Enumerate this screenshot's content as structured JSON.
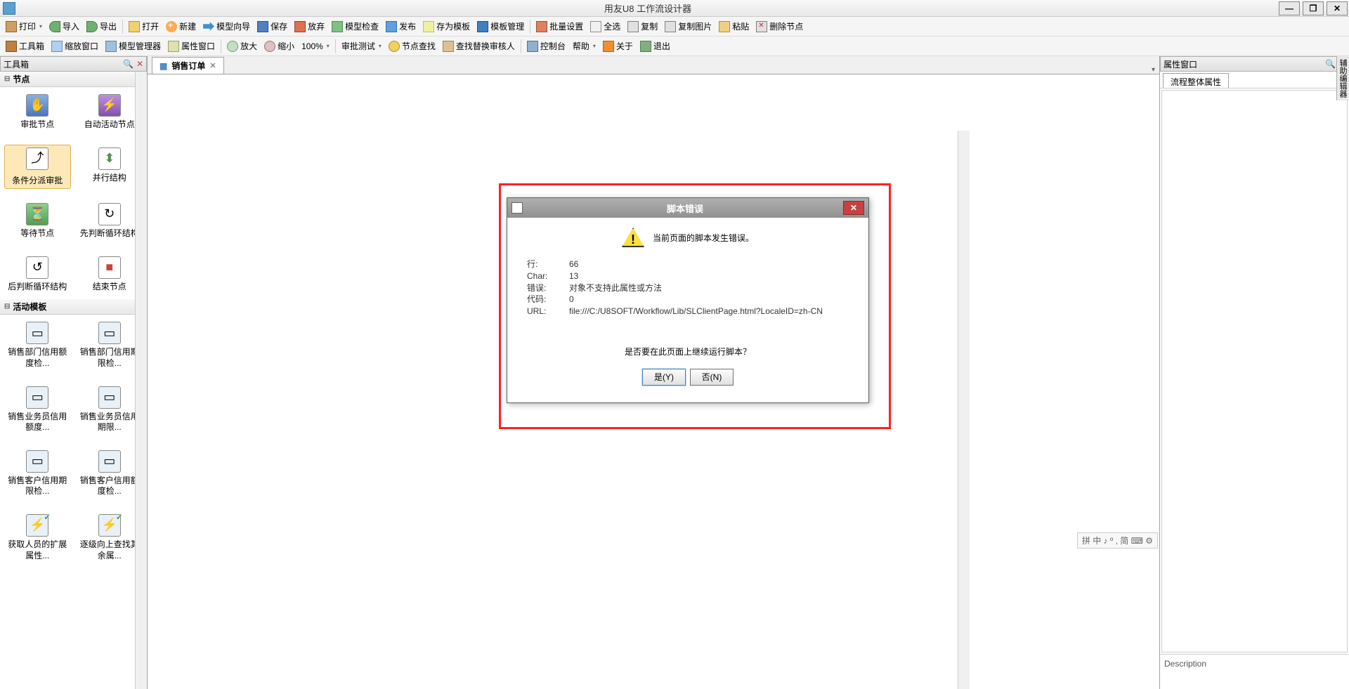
{
  "window": {
    "title": "用友U8 工作流设计器"
  },
  "toolbar1": {
    "print": "打印",
    "import": "导入",
    "export": "导出",
    "open": "打开",
    "new": "新建",
    "wizard": "模型向导",
    "save": "保存",
    "discard": "放弃",
    "check": "模型检查",
    "publish": "发布",
    "saveAsTpl": "存为模板",
    "tplManage": "模板管理",
    "batch": "批量设置",
    "selectAll": "全选",
    "copy": "复制",
    "copyImg": "复制图片",
    "paste": "粘贴",
    "delNode": "删除节点"
  },
  "toolbar2": {
    "toolbox": "工具箱",
    "fitWindow": "缩放窗口",
    "modelMgr": "模型管理器",
    "propWin": "属性窗口",
    "zoomIn": "放大",
    "zoomOut": "缩小",
    "zoomPct": "100%",
    "test": "审批测试",
    "findNode": "节点查找",
    "replaceReviewer": "查找替换审核人",
    "console": "控制台",
    "help": "帮助",
    "about": "关于",
    "exit": "退出"
  },
  "leftPanel": {
    "title": "工具箱",
    "sectionNodes": "节点",
    "sectionTemplates": "活动模板",
    "nodes": [
      {
        "label": "审批节点"
      },
      {
        "label": "自动活动节点"
      },
      {
        "label": "条件分派审批"
      },
      {
        "label": "并行结构"
      },
      {
        "label": "等待节点"
      },
      {
        "label": "先判断循环结构"
      },
      {
        "label": "后判断循环结构"
      },
      {
        "label": "结束节点"
      }
    ],
    "templates": [
      {
        "label": "销售部门信用额度检..."
      },
      {
        "label": "销售部门信用期限检..."
      },
      {
        "label": "销售业务员信用额度..."
      },
      {
        "label": "销售业务员信用期限..."
      },
      {
        "label": "销售客户信用期限检..."
      },
      {
        "label": "销售客户信用额度检..."
      },
      {
        "label": "获取人员的扩展属性..."
      },
      {
        "label": "逐级向上查找其余属..."
      }
    ]
  },
  "docTab": {
    "label": "销售订单"
  },
  "dialog": {
    "title": "脚本错误",
    "message": "当前页面的脚本发生错误。",
    "lineLabel": "行:",
    "lineVal": "66",
    "charLabel": "Char:",
    "charVal": "13",
    "errLabel": "错误:",
    "errVal": "对象不支持此属性或方法",
    "codeLabel": "代码:",
    "codeVal": "0",
    "urlLabel": "URL:",
    "urlVal": "file:///C:/U8SOFT/Workflow/Lib/SLClientPage.html?LocaleID=zh-CN",
    "question": "是否要在此页面上继续运行脚本？",
    "yes": "是(Y)",
    "no": "否(N)"
  },
  "rightPanel": {
    "title": "属性窗口",
    "tab": "流程整体属性",
    "desc": "Description"
  },
  "ime": "拼 中 ♪ º , 简 ⌨ ⚙",
  "rightStrip": "辅助编辑器"
}
